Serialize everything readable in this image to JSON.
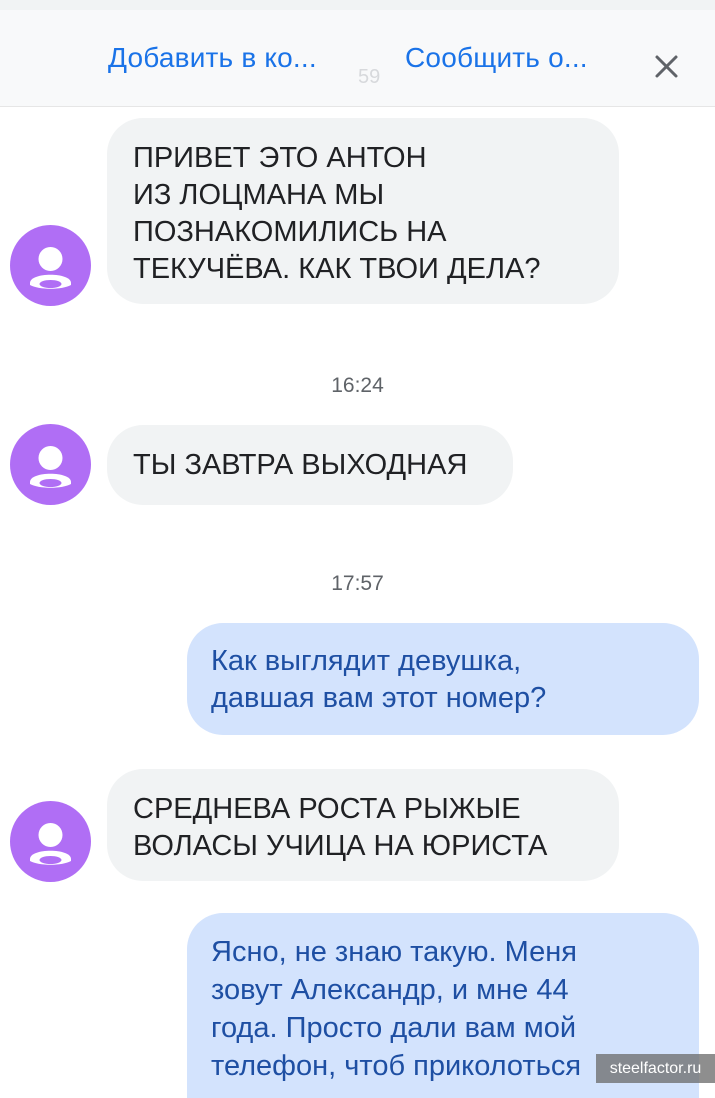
{
  "toolbar": {
    "add_contact_label": "Добавить в ко...",
    "report_label": "Сообщить о...",
    "close_icon": "close-icon",
    "faded_time": "59"
  },
  "avatar": {
    "color": "#b06ef5",
    "icon": "person-icon"
  },
  "colors": {
    "incoming_bubble": "#f1f3f4",
    "outgoing_bubble": "#d3e3fd",
    "outgoing_text": "#1e4fa3",
    "accent": "#1a73e8"
  },
  "messages": [
    {
      "direction": "incoming",
      "text": "ПРИВЕТ ЭТО АНТОН\nИЗ ЛОЦМАНА МЫ\nПОЗНАКОМИЛИСЬ НА\nТЕКУЧЁВА. КАК ТВОИ ДЕЛА?"
    },
    {
      "timestamp": "16:24"
    },
    {
      "direction": "incoming",
      "text": "ТЫ ЗАВТРА ВЫХОДНАЯ"
    },
    {
      "timestamp": "17:57"
    },
    {
      "direction": "outgoing",
      "text": "Как выглядит девушка,\nдавшая вам этот номер?"
    },
    {
      "direction": "incoming",
      "text": "СРЕДНЕВА РОСТА РЫЖЫЕ\nВОЛАСЫ УЧИЦА НА ЮРИСТА"
    },
    {
      "direction": "outgoing",
      "text": "Ясно, не знаю такую. Меня\nзовут Александр, и мне 44\nгода. Просто дали вам мой\nтелефон, чтоб приколоться"
    }
  ],
  "watermark": "steelfactor.ru"
}
